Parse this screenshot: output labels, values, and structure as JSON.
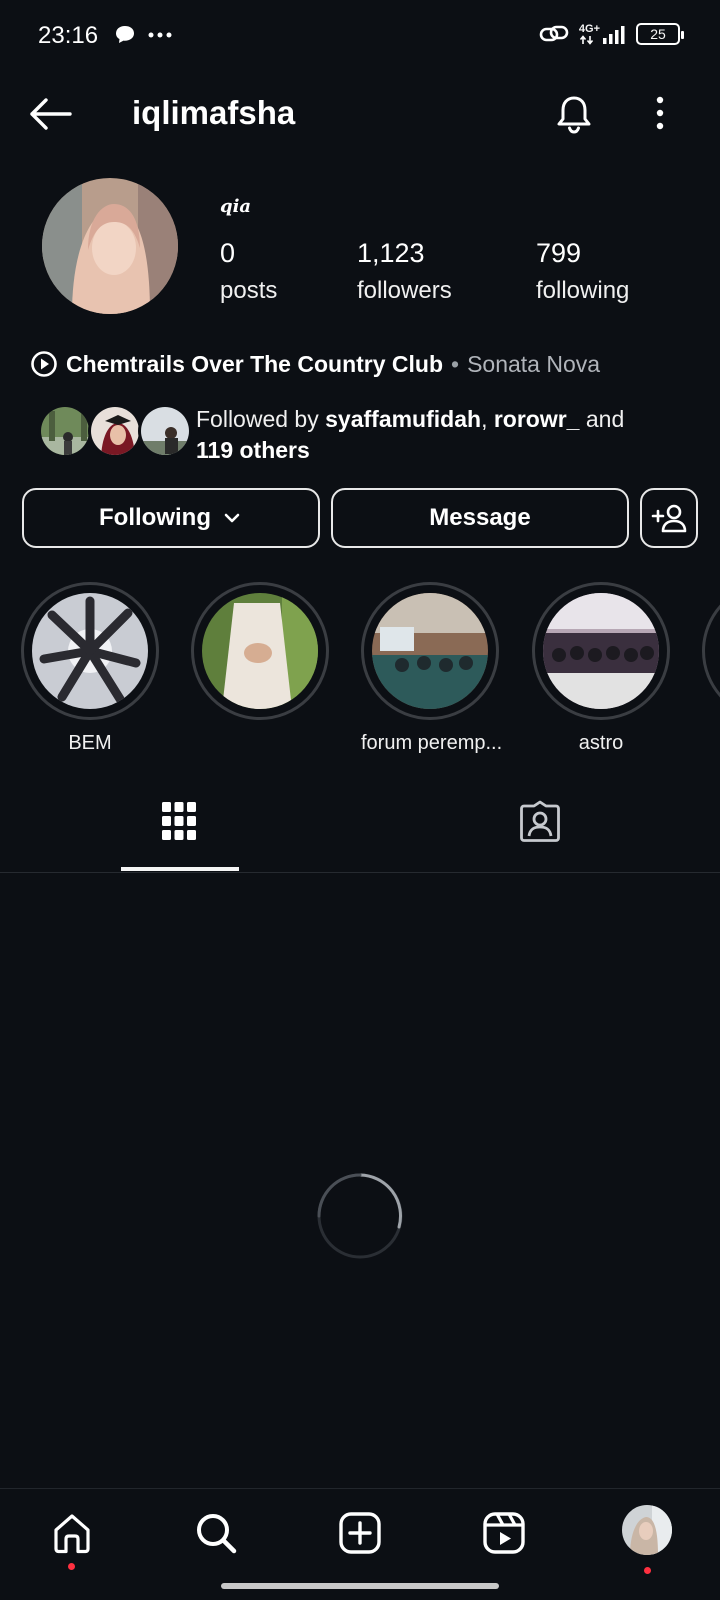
{
  "status_bar": {
    "time": "23:16",
    "network": "4G+",
    "battery": "25"
  },
  "header": {
    "username": "iqlimafsha"
  },
  "profile": {
    "display_name": "qia",
    "posts_count": "0",
    "posts_label": "posts",
    "followers_count": "1,123",
    "followers_label": "followers",
    "following_count": "799",
    "following_label": "following"
  },
  "music": {
    "song": "Chemtrails Over The Country Club",
    "separator": "•",
    "artist": "Sonata Nova"
  },
  "followed_by": {
    "prefix": "Followed by ",
    "user1": "syaffamufidah",
    "comma": ", ",
    "user2": "rorowr_",
    "suffix": " and",
    "others": "119 others"
  },
  "actions": {
    "following_label": "Following",
    "message_label": "Message"
  },
  "highlights": [
    {
      "label": "BEM"
    },
    {
      "label": ""
    },
    {
      "label": "forum peremp..."
    },
    {
      "label": "astro"
    }
  ],
  "icons": {
    "back": "arrow-left-icon",
    "bell": "bell-icon",
    "more": "more-vertical-icon",
    "add_user": "add-user-icon",
    "grid": "grid-icon",
    "tagged": "tagged-icon",
    "home": "home-icon",
    "search": "search-icon",
    "create": "plus-square-icon",
    "reels": "reels-icon"
  },
  "colors": {
    "background": "#0c0f14",
    "notification_dot": "#ff3040"
  }
}
